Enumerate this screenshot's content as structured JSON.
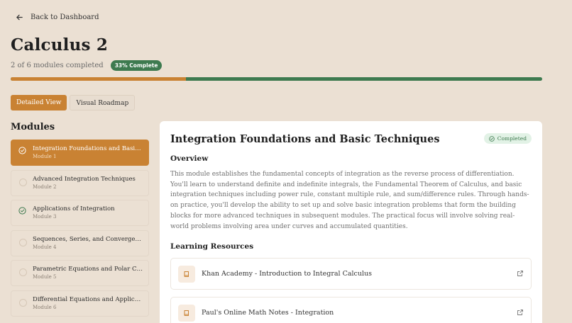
{
  "nav": {
    "back_label": "Back to Dashboard"
  },
  "course": {
    "title": "Calculus 2",
    "progress_text": "2 of 6 modules completed",
    "progress_badge": "33% Complete",
    "progress_fraction": 0.33
  },
  "view_toggle": {
    "detailed": "Detailed View",
    "roadmap": "Visual Roadmap"
  },
  "sidebar": {
    "heading": "Modules",
    "modules": [
      {
        "name": "Integration Foundations and Basic Techniques",
        "sub": "Module 1",
        "status": "completed",
        "active": true
      },
      {
        "name": "Advanced Integration Techniques",
        "sub": "Module 2",
        "status": "incomplete",
        "active": false
      },
      {
        "name": "Applications of Integration",
        "sub": "Module 3",
        "status": "completed",
        "active": false
      },
      {
        "name": "Sequences, Series, and Convergence",
        "sub": "Module 4",
        "status": "incomplete",
        "active": false
      },
      {
        "name": "Parametric Equations and Polar Coordinates",
        "sub": "Module 5",
        "status": "incomplete",
        "active": false
      },
      {
        "name": "Differential Equations and Applications",
        "sub": "Module 6",
        "status": "incomplete",
        "active": false
      }
    ]
  },
  "detail": {
    "title": "Integration Foundations and Basic Techniques",
    "status_badge": "Completed",
    "overview_heading": "Overview",
    "overview_text": "This module establishes the fundamental concepts of integration as the reverse process of differentiation. You'll learn to understand definite and indefinite integrals, the Fundamental Theorem of Calculus, and basic integration techniques including power rule, constant multiple rule, and sum/difference rules. Through hands-on practice, you'll develop the ability to set up and solve basic integration problems that form the building blocks for more advanced techniques in subsequent modules. The practical focus will involve solving real-world problems involving area under curves and accumulated quantities.",
    "resources_heading": "Learning Resources",
    "resources": [
      {
        "label": "Khan Academy - Introduction to Integral Calculus"
      },
      {
        "label": "Paul's Online Math Notes - Integration"
      }
    ]
  },
  "colors": {
    "accent": "#c98233",
    "success": "#3d7a4f",
    "background": "#ebe0d3"
  },
  "icons": {
    "back": "arrow-left-icon",
    "completed": "check-circle-icon",
    "resource": "book-icon",
    "external": "external-link-icon"
  }
}
